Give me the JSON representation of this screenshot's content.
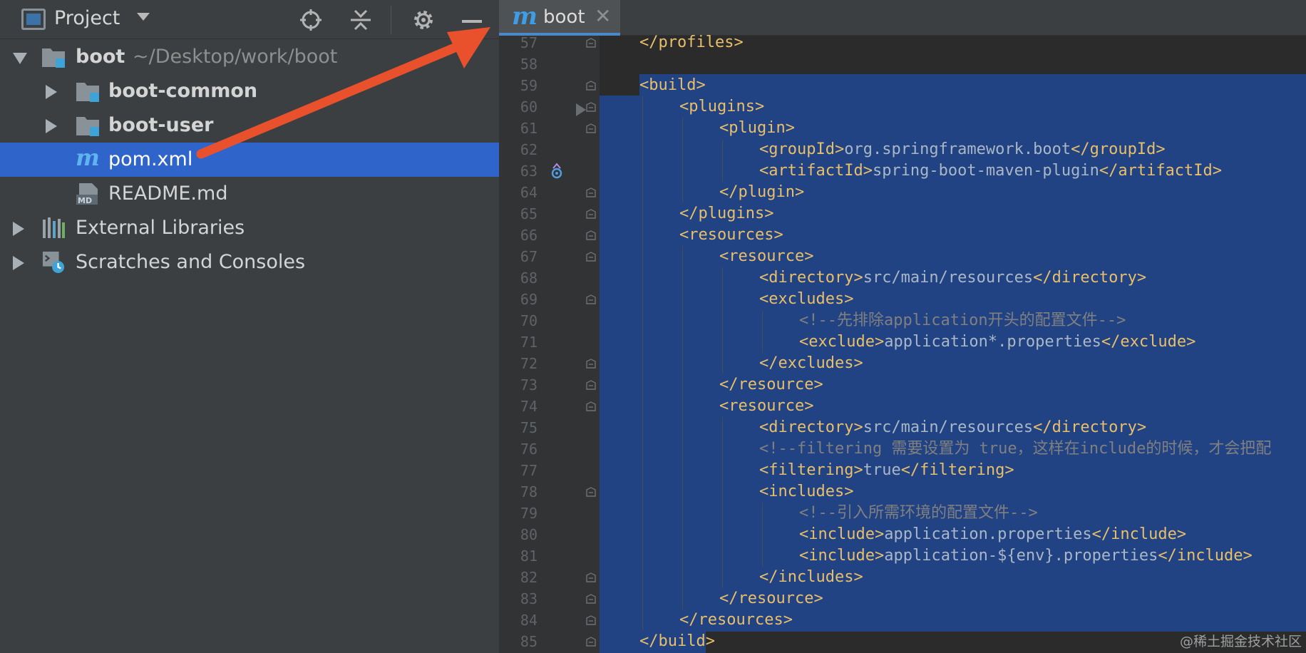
{
  "project_panel": {
    "title": "Project",
    "tree": [
      {
        "name": "boot",
        "path": "~/Desktop/work/boot"
      },
      {
        "name": "boot-common"
      },
      {
        "name": "boot-user"
      },
      {
        "name": "pom.xml",
        "selected": true
      },
      {
        "name": "README.md"
      },
      {
        "name": "External Libraries"
      },
      {
        "name": "Scratches and Consoles"
      }
    ]
  },
  "editor": {
    "tab_label": "boot",
    "tab_close": "✕",
    "tab_icon_glyph": "m",
    "lines": [
      {
        "n": "57",
        "parts": [
          [
            "t",
            "</profiles>"
          ]
        ]
      },
      {
        "n": "58",
        "parts": []
      },
      {
        "n": "59",
        "parts": [
          [
            "t",
            "<build>"
          ]
        ]
      },
      {
        "n": "60",
        "parts": [
          [
            "t",
            "<plugins>"
          ]
        ]
      },
      {
        "n": "61",
        "parts": [
          [
            "t",
            "<plugin>"
          ]
        ]
      },
      {
        "n": "62",
        "parts": [
          [
            "t",
            "<groupId>"
          ],
          [
            "x",
            "org.springframework.boot"
          ],
          [
            "t",
            "</groupId>"
          ]
        ]
      },
      {
        "n": "63",
        "parts": [
          [
            "t",
            "<artifactId>"
          ],
          [
            "x",
            "spring-boot-maven-plugin"
          ],
          [
            "t",
            "</artifactId>"
          ]
        ]
      },
      {
        "n": "64",
        "parts": [
          [
            "t",
            "</plugin>"
          ]
        ]
      },
      {
        "n": "65",
        "parts": [
          [
            "t",
            "</plugins>"
          ]
        ]
      },
      {
        "n": "66",
        "parts": [
          [
            "t",
            "<resources>"
          ]
        ]
      },
      {
        "n": "67",
        "parts": [
          [
            "t",
            "<resource>"
          ]
        ]
      },
      {
        "n": "68",
        "parts": [
          [
            "t",
            "<directory>"
          ],
          [
            "x",
            "src/main/resources"
          ],
          [
            "t",
            "</directory>"
          ]
        ]
      },
      {
        "n": "69",
        "parts": [
          [
            "t",
            "<excludes>"
          ]
        ]
      },
      {
        "n": "70",
        "parts": [
          [
            "c",
            "<!--先排除application开头的配置文件-->"
          ]
        ]
      },
      {
        "n": "71",
        "parts": [
          [
            "t",
            "<exclude>"
          ],
          [
            "x",
            "application*.properties"
          ],
          [
            "t",
            "</exclude>"
          ]
        ]
      },
      {
        "n": "72",
        "parts": [
          [
            "t",
            "</excludes>"
          ]
        ]
      },
      {
        "n": "73",
        "parts": [
          [
            "t",
            "</resource>"
          ]
        ]
      },
      {
        "n": "74",
        "parts": [
          [
            "t",
            "<resource>"
          ]
        ]
      },
      {
        "n": "75",
        "parts": [
          [
            "t",
            "<directory>"
          ],
          [
            "x",
            "src/main/resources"
          ],
          [
            "t",
            "</directory>"
          ]
        ]
      },
      {
        "n": "76",
        "parts": [
          [
            "c",
            "<!--filtering 需要设置为 true，这样在include的时候，才会把配"
          ]
        ]
      },
      {
        "n": "77",
        "parts": [
          [
            "t",
            "<filtering>"
          ],
          [
            "x",
            "true"
          ],
          [
            "t",
            "</filtering>"
          ]
        ]
      },
      {
        "n": "78",
        "parts": [
          [
            "t",
            "<includes>"
          ]
        ]
      },
      {
        "n": "79",
        "parts": [
          [
            "c",
            "<!--引入所需环境的配置文件-->"
          ]
        ]
      },
      {
        "n": "80",
        "parts": [
          [
            "t",
            "<include>"
          ],
          [
            "x",
            "application.properties"
          ],
          [
            "t",
            "</include>"
          ]
        ]
      },
      {
        "n": "81",
        "parts": [
          [
            "t",
            "<include>"
          ],
          [
            "x",
            "application-${env}.properties"
          ],
          [
            "t",
            "</include>"
          ]
        ]
      },
      {
        "n": "82",
        "parts": [
          [
            "t",
            "</includes>"
          ]
        ]
      },
      {
        "n": "83",
        "parts": [
          [
            "t",
            "</resource>"
          ]
        ]
      },
      {
        "n": "84",
        "parts": [
          [
            "t",
            "</resources>"
          ]
        ]
      },
      {
        "n": "85",
        "parts": [
          [
            "t",
            "</build>"
          ]
        ]
      }
    ]
  },
  "watermark": "@稀土掘金技术社区",
  "colors": {
    "selection": "#214283",
    "tag": "#e8bf6a",
    "text": "#a9b7c6",
    "comment": "#808080",
    "tree_selected": "#2f65ca",
    "annotation_arrow": "#e8512c"
  }
}
